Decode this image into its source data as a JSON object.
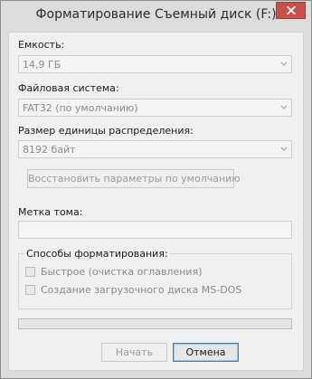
{
  "window": {
    "title": "Форматирование Съемный диск (F:)"
  },
  "capacity": {
    "label": "Емкость:",
    "value": "14,9 ГБ"
  },
  "filesystem": {
    "label": "Файловая система:",
    "value": "FAT32 (по умолчанию)"
  },
  "allocation": {
    "label": "Размер единицы распределения:",
    "value": "8192 байт"
  },
  "restore_defaults_label": "Восстановить параметры по умолчанию",
  "volume_label": {
    "label": "Метка тома:",
    "value": ""
  },
  "format_options": {
    "title": "Способы форматирования:",
    "quick": {
      "label": "Быстрое (очистка оглавления)",
      "checked": false
    },
    "msdos": {
      "label": "Создание загрузочного диска MS-DOS",
      "checked": false
    }
  },
  "progress": {
    "fraction": 0
  },
  "buttons": {
    "start_label": "Начать",
    "cancel_label": "Отмена"
  },
  "colors": {
    "close_button": "#c7504a",
    "primary_button_border": "#3c7fb1",
    "progress_fill": "#06b025"
  },
  "icons": {
    "close": "close-icon",
    "dropdown": "chevron-down-icon"
  }
}
